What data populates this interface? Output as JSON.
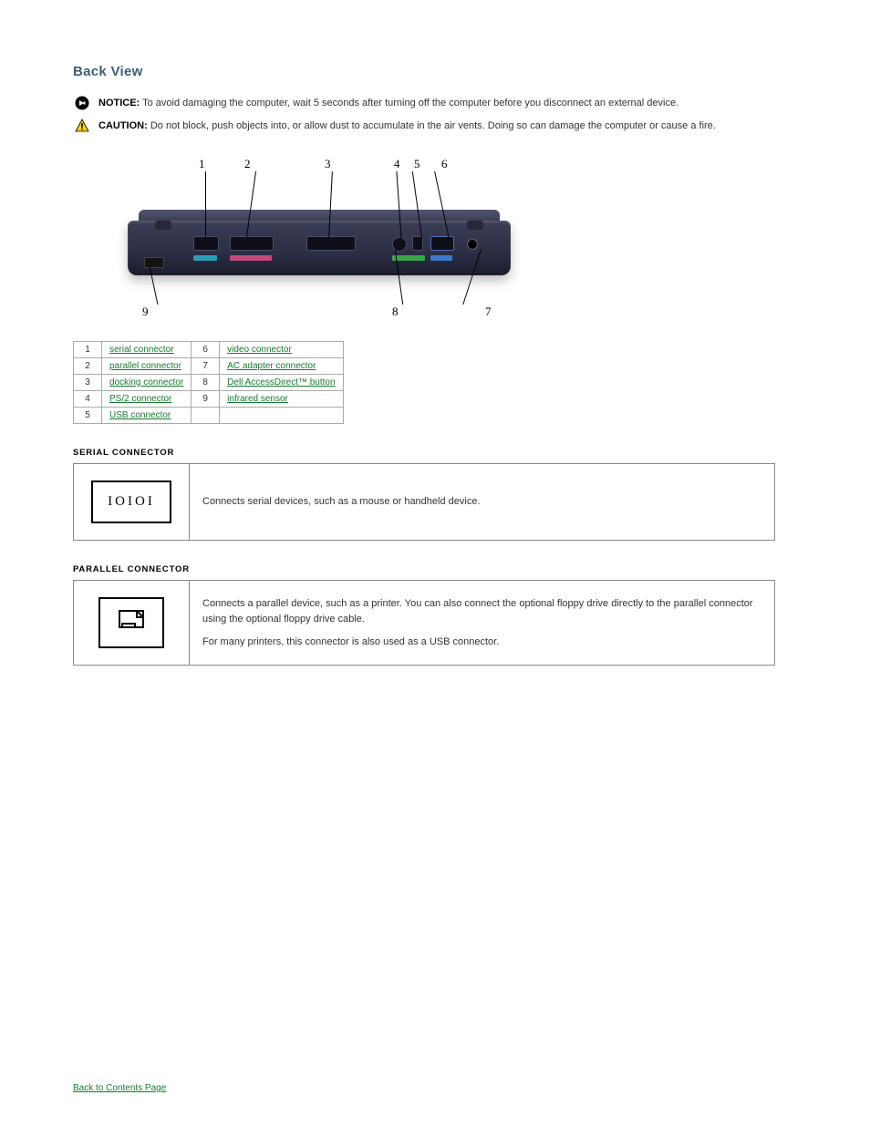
{
  "title": "Back View",
  "notice": {
    "label": "NOTICE:",
    "text": "To avoid damaging the computer, wait 5 seconds after turning off the computer before you disconnect an external device."
  },
  "caution": {
    "label": "CAUTION:",
    "text": "Do not block, push objects into, or allow dust to accumulate in the air vents. Doing so can damage the computer or cause a fire."
  },
  "callouts": [
    "1",
    "2",
    "3",
    "4",
    "5",
    "6",
    "7",
    "8",
    "9"
  ],
  "index": [
    {
      "n": "1",
      "label": "serial connector"
    },
    {
      "n": "2",
      "label": "parallel connector"
    },
    {
      "n": "3",
      "label": "docking connector"
    },
    {
      "n": "4",
      "label": "PS/2 connector"
    },
    {
      "n": "5",
      "label": "USB connector"
    },
    {
      "n": "6",
      "label": "video connector"
    },
    {
      "n": "7",
      "label": "AC adapter connector"
    },
    {
      "n": "8",
      "label": "Dell AccessDirect™ button"
    },
    {
      "n": "9",
      "label": "infrared sensor"
    }
  ],
  "connectors": {
    "serial": {
      "heading": "SERIAL CONNECTOR",
      "icon_text": "IOIOI",
      "body": "Connects serial devices, such as a mouse or handheld device."
    },
    "parallel": {
      "heading": "PARALLEL CONNECTOR",
      "body_line1": "Connects a parallel device, such as a printer. You can also connect the optional floppy drive directly to the parallel connector using the optional floppy drive cable.",
      "body_line2": "For many printers, this connector is also used as a USB connector."
    }
  },
  "footer": {
    "label": "Back to Contents Page"
  }
}
